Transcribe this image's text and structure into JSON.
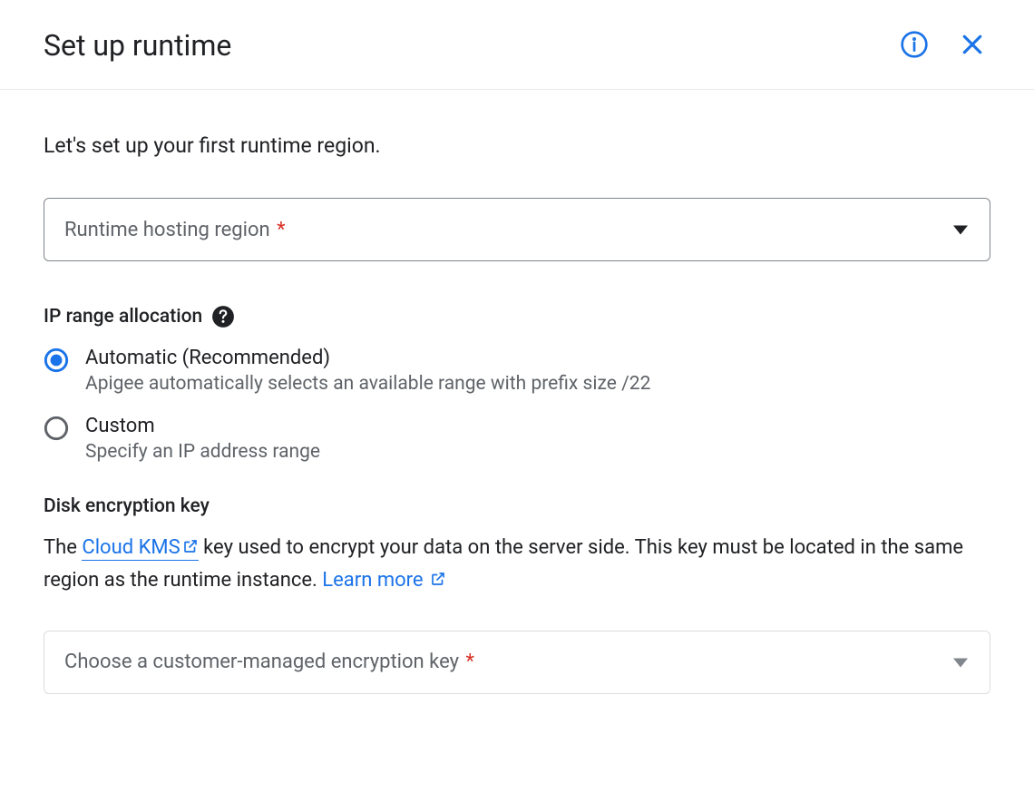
{
  "header": {
    "title": "Set up runtime"
  },
  "intro": "Let's set up your first runtime region.",
  "regionSelect": {
    "label": "Runtime hosting region",
    "required": "*"
  },
  "ipRange": {
    "heading": "IP range allocation",
    "options": [
      {
        "label": "Automatic (Recommended)",
        "desc": "Apigee automatically selects an available range with prefix size /22",
        "selected": true
      },
      {
        "label": "Custom",
        "desc": "Specify an IP address range",
        "selected": false
      }
    ]
  },
  "encryption": {
    "heading": "Disk encryption key",
    "desc_prefix": "The ",
    "link1": "Cloud KMS",
    "desc_mid": " key used to encrypt your data on the server side. This key must be located in the same region as the runtime instance. ",
    "link2": "Learn more",
    "select_label": "Choose a customer-managed encryption key",
    "required": "*"
  }
}
